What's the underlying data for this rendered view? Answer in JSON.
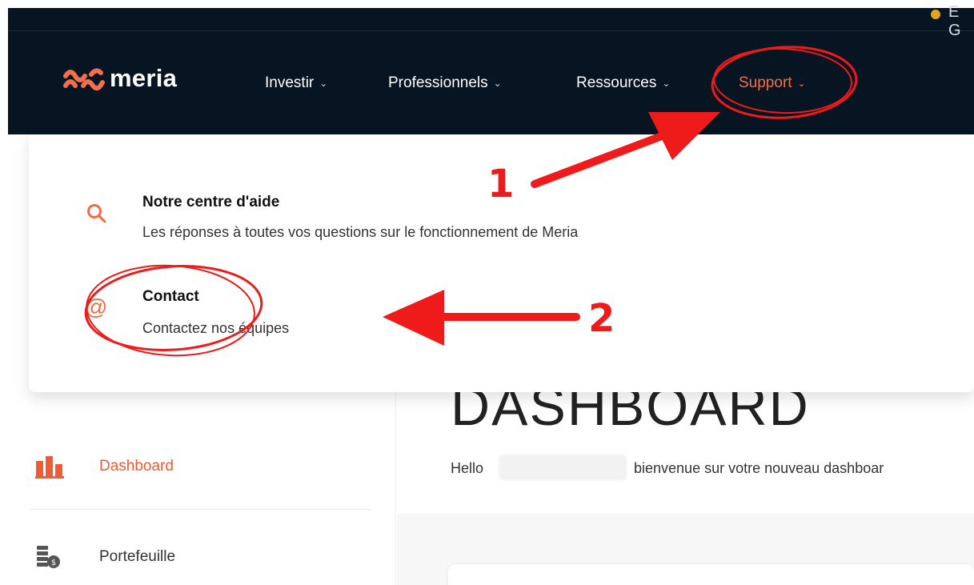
{
  "header": {
    "language_partial": "E G",
    "logo_text": "meria",
    "nav": [
      {
        "label": "Investir",
        "chevron": "chevron-down-icon"
      },
      {
        "label": "Professionnels",
        "chevron": "chevron-down-icon"
      },
      {
        "label": "Ressources",
        "chevron": "chevron-down-icon"
      },
      {
        "label": "Support",
        "chevron": "chevron-down-icon",
        "active": true
      }
    ]
  },
  "support_menu": {
    "items": [
      {
        "title": "Notre centre d'aide",
        "description": "Les réponses à toutes vos questions sur le fonctionnement de Meria",
        "icon": "search-icon"
      },
      {
        "title": "Contact",
        "description": "Contactez nos équipes",
        "icon": "at-sign-icon"
      }
    ]
  },
  "sidebar": {
    "items": [
      {
        "label": "Dashboard",
        "icon": "bar-chart-icon",
        "active": true
      },
      {
        "label": "Portefeuille",
        "icon": "coins-icon"
      }
    ]
  },
  "main": {
    "title": "DASHBOARD",
    "greeting": "Hello",
    "welcome": "bienvenue sur votre nouveau dashboar"
  },
  "annotations": {
    "step1": "1",
    "step2": "2"
  },
  "colors": {
    "navbar_bg": "#071421",
    "accent": "#f36f4b",
    "annotation_red": "#ef1b1b"
  }
}
